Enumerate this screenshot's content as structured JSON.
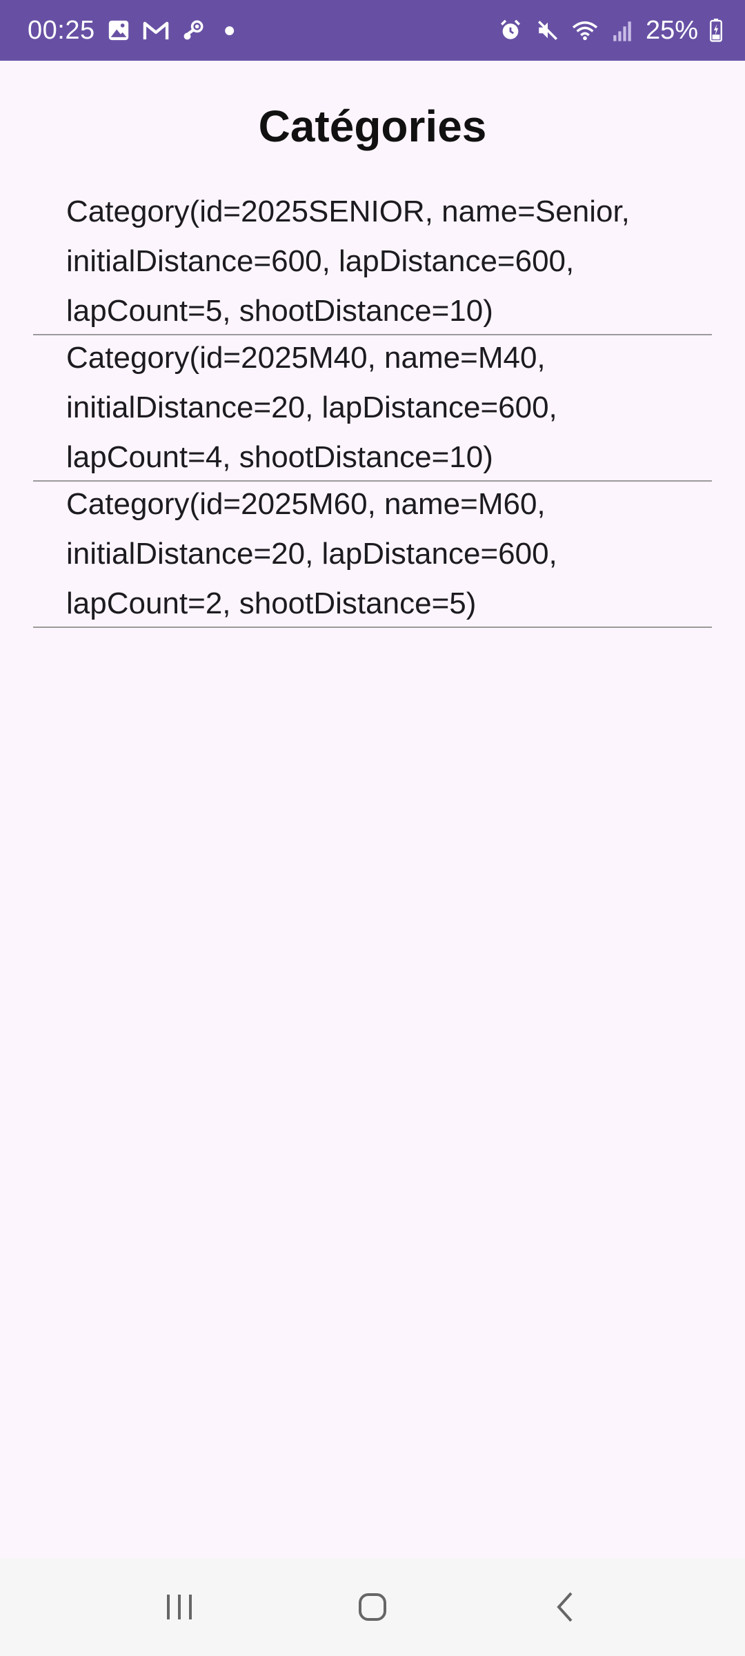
{
  "status_bar": {
    "time": "00:25",
    "battery": "25%",
    "icons_left": [
      "gallery-icon",
      "gmail-icon",
      "steam-icon",
      "notification-dot"
    ],
    "icons_right": [
      "alarm-icon",
      "mute-icon",
      "wifi-icon",
      "signal-icon",
      "battery-icon"
    ],
    "color": "#6750a4"
  },
  "page": {
    "title": "Catégories",
    "background": "#fdf5fd"
  },
  "categories": [
    {
      "text": "Category(id=2025SENIOR, name=Senior, initialDistance=600, lapDistance=600, lapCount=5, shootDistance=10)"
    },
    {
      "text": "Category(id=2025M40, name=M40, initialDistance=20, lapDistance=600, lapCount=4, shootDistance=10)"
    },
    {
      "text": "Category(id=2025M60, name=M60, initialDistance=20, lapDistance=600, lapCount=2, shootDistance=5)"
    }
  ],
  "nav_bar": {
    "buttons": [
      "recents-icon",
      "home-icon",
      "back-icon"
    ]
  }
}
